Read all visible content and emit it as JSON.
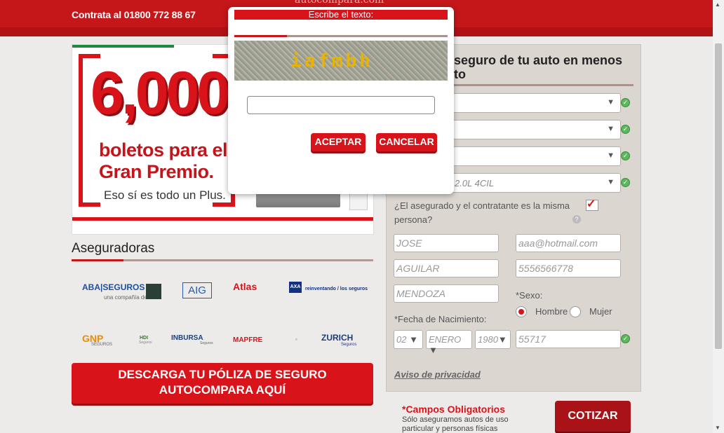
{
  "header": {
    "phone": "Contrata al 01800 772 88 67",
    "brand": "autocompara.com"
  },
  "banner": {
    "number": "6,000",
    "line1": "boletos para el",
    "line2": "Gran Premio.",
    "line3": "Eso sí es todo un Plus."
  },
  "insurers": {
    "title": "Aseguradoras",
    "logos": [
      "ABA|SEGUROS",
      "una compañía de",
      "AIG",
      "Atlas",
      "AXA",
      "reinventando / los seguros",
      "GNP",
      "SEGUROS",
      "HDI",
      "Seguros",
      "INBURSA",
      "Seguros",
      "MAPFRE",
      "ZURICH",
      "Seguros"
    ]
  },
  "download_button": {
    "line1": "DESCARGA TU PÓLIZA DE SEGURO",
    "line2": "AUTOCOMPARA AQUÍ"
  },
  "form": {
    "heading": "seguro de tu auto en menos\nto",
    "version_value": "2.0L 4CIL",
    "question": "¿El asegurado y el contratante es la misma persona?",
    "fields": {
      "first_name": "JOSE",
      "email": "aaa@hotmail.com",
      "last_name1": "AGUILAR",
      "phone": "5556566778",
      "last_name2": "MENDOZA",
      "zip": "55717"
    },
    "sex_label": "*Sexo:",
    "sex_options": [
      "Hombre",
      "Mujer"
    ],
    "sex_selected": "Hombre",
    "birth_label": "*Fecha de Nacimiento:",
    "birth_day": "02",
    "birth_month": "ENERO",
    "birth_year": "1980",
    "privacy_link": "Aviso de privacidad",
    "required_note": "*Campos Obligatorios",
    "sub_note": "Sólo aseguramos autos de uso particular y personas físicas",
    "submit": "COTIZAR"
  },
  "modal": {
    "title": "Escribe el texto:",
    "captcha_text": "iafmbh",
    "input_value": "",
    "accept": "ACEPTAR",
    "cancel": "CANCELAR"
  },
  "colors": {
    "brand_red": "#c5161a",
    "button_red": "#d8131a",
    "dark_red": "#a91217",
    "panel": "#dcd6d1"
  }
}
